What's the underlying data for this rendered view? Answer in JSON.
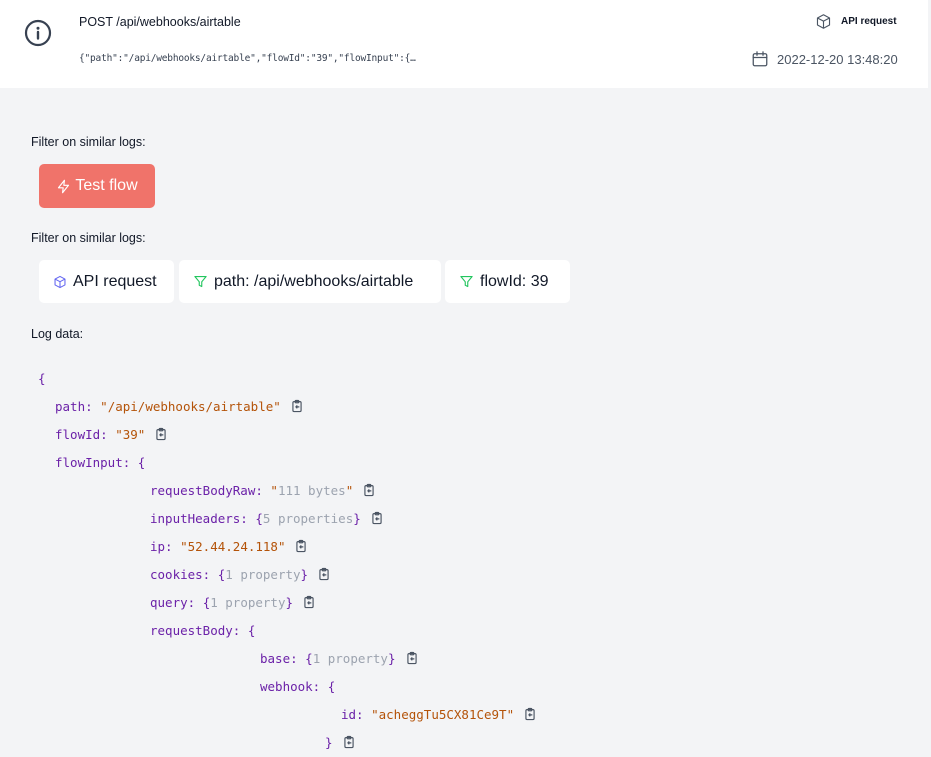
{
  "header": {
    "title": "POST /api/webhooks/airtable",
    "subtitle": "{\"path\":\"/api/webhooks/airtable\",\"flowId\":\"39\",\"flowInput\":{…",
    "type_label": "API request",
    "datetime": "2022-12-20 13:48:20"
  },
  "sections": {
    "filter_label_1": "Filter on similar logs:",
    "filter_label_2": "Filter on similar logs:",
    "log_data_label": "Log data:"
  },
  "actions": {
    "test_flow": "Test flow"
  },
  "filters": {
    "api_request": "API request",
    "path": "path: /api/webhooks/airtable",
    "flow_id": "flowId: 39"
  },
  "json_view": {
    "open_brace": "{",
    "path_key": "path:",
    "path_val": "\"/api/webhooks/airtable\"",
    "flowid_key": "flowId:",
    "flowid_val": "\"39\"",
    "flowinput_key": "flowInput:",
    "flowinput_open": "{",
    "rbr_key": "requestBodyRaw:",
    "rbr_q1": "\"",
    "rbr_val": "111 bytes",
    "rbr_q2": "\"",
    "ih_key": "inputHeaders:",
    "ih_open": "{",
    "ih_summary": "5 properties",
    "ih_close": "}",
    "ip_key": "ip:",
    "ip_val": "\"52.44.24.118\"",
    "cookies_key": "cookies:",
    "cookies_open": "{",
    "cookies_summary": "1 property",
    "cookies_close": "}",
    "query_key": "query:",
    "query_open": "{",
    "query_summary": "1 property",
    "query_close": "}",
    "rb_key": "requestBody:",
    "rb_open": "{",
    "base_key": "base:",
    "base_open": "{",
    "base_summary": "1 property",
    "base_close": "}",
    "webhook_key": "webhook:",
    "webhook_open": "{",
    "id_key": "id:",
    "id_val": "\"acheggTu5CX81Ce9T\"",
    "webhook_close": "}"
  },
  "colors": {
    "accent": "#f0736a",
    "json_key": "#6b21a8",
    "json_string": "#b45309",
    "filter_icon": "#22c55e",
    "cube_icon": "#6366f1"
  }
}
